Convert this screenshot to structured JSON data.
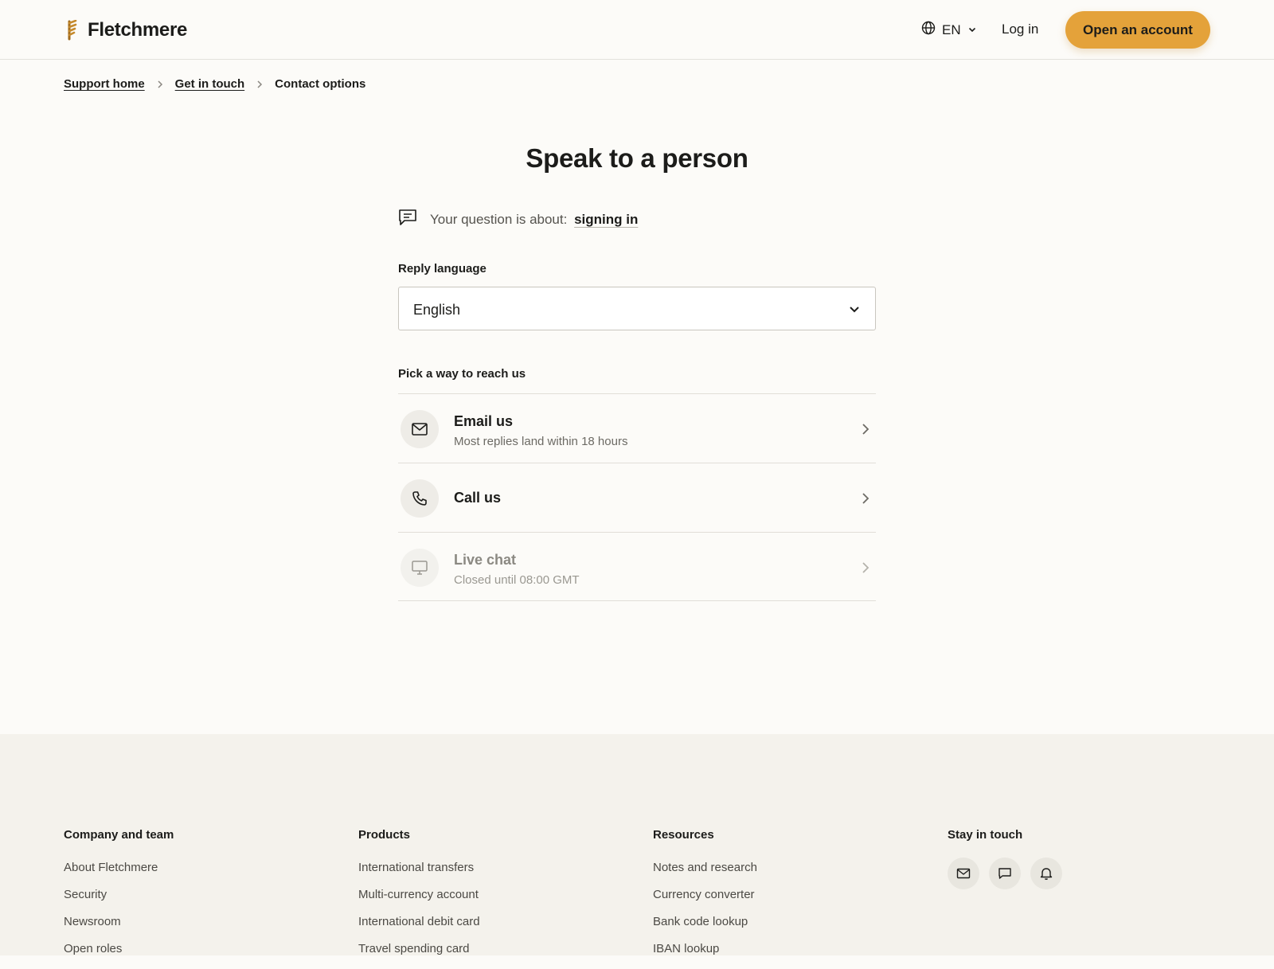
{
  "header": {
    "brand_name": "Fletchmere",
    "brand_icon": "feather-logo-icon",
    "language_code": "EN",
    "login_label": "Log in",
    "cta_label": "Open an account"
  },
  "breadcrumb": {
    "items": [
      {
        "label": "Support home",
        "link": true
      },
      {
        "label": "Get in touch",
        "link": true
      },
      {
        "label": "Contact options",
        "link": false
      }
    ]
  },
  "main": {
    "title": "Speak to a person",
    "topic_prefix": "Your question is about:",
    "topic_value": "signing in",
    "reply_language_label": "Reply language",
    "reply_language_value": "English",
    "section_label": "Pick a way to reach us",
    "options": [
      {
        "title": "Email us",
        "subtitle": "Most replies land within 18 hours",
        "icon": "envelope-icon",
        "disabled": false
      },
      {
        "title": "Call us",
        "subtitle": "",
        "icon": "phone-icon",
        "disabled": false
      },
      {
        "title": "Live chat",
        "subtitle": "Closed until 08:00 GMT",
        "icon": "monitor-icon",
        "disabled": true
      }
    ]
  },
  "footer": {
    "columns": [
      {
        "heading": "Company and team",
        "links": [
          "About Fletchmere",
          "Security",
          "Newsroom",
          "Open roles"
        ]
      },
      {
        "heading": "Products",
        "links": [
          "International transfers",
          "Multi-currency account",
          "International debit card",
          "Travel spending card"
        ]
      },
      {
        "heading": "Resources",
        "links": [
          "Notes and research",
          "Currency converter",
          "Bank code lookup",
          "IBAN lookup"
        ]
      }
    ],
    "stay_in_touch_heading": "Stay in touch",
    "social_icons": [
      "envelope-icon",
      "chat-bubble-icon",
      "bell-icon"
    ]
  },
  "colors": {
    "accent": "#e4a23a",
    "brand_mark": "#a06a1c",
    "page_bg": "#fcfbf8",
    "footer_bg": "#f4f2ec"
  }
}
